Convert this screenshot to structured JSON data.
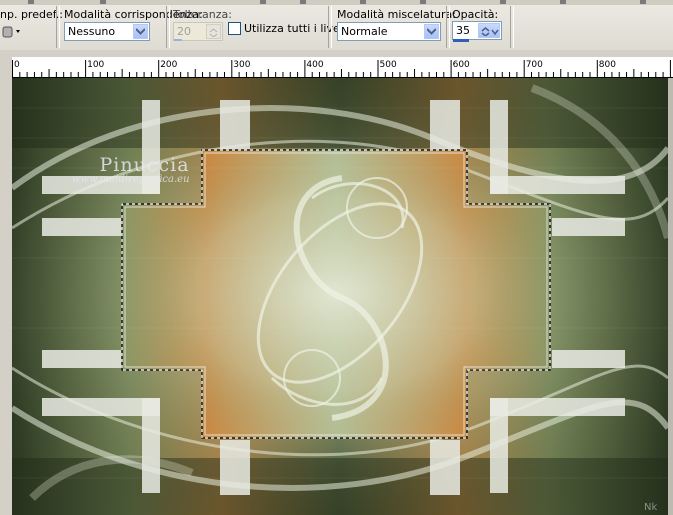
{
  "toolbar": {
    "preset_label": "np. predef.:",
    "match_mode": {
      "label": "Modalità corrispondenza:",
      "value": "Nessuno"
    },
    "tolerance": {
      "label": "Tolleranza:",
      "value": "20"
    },
    "use_all_layers": {
      "label": "Utilizza tutti i livelli",
      "checked": false
    },
    "blend_mode": {
      "label": "Modalità miscelatura:",
      "value": "Normale"
    },
    "opacity": {
      "label": "Opacità:",
      "value": "35"
    }
  },
  "ruler": {
    "labels": [
      "0",
      "100",
      "200",
      "300",
      "400",
      "500",
      "600",
      "700",
      "800"
    ]
  },
  "canvas": {
    "watermark_title": "Pinuccia",
    "watermark_url": "www.maidiregrafica.eu",
    "corner_mark": "Nk"
  },
  "colors": {
    "dark_green": "#2c3a24",
    "olive": "#7f8f60",
    "orange": "#c07a3a",
    "pale_green": "#cfd8bd"
  }
}
